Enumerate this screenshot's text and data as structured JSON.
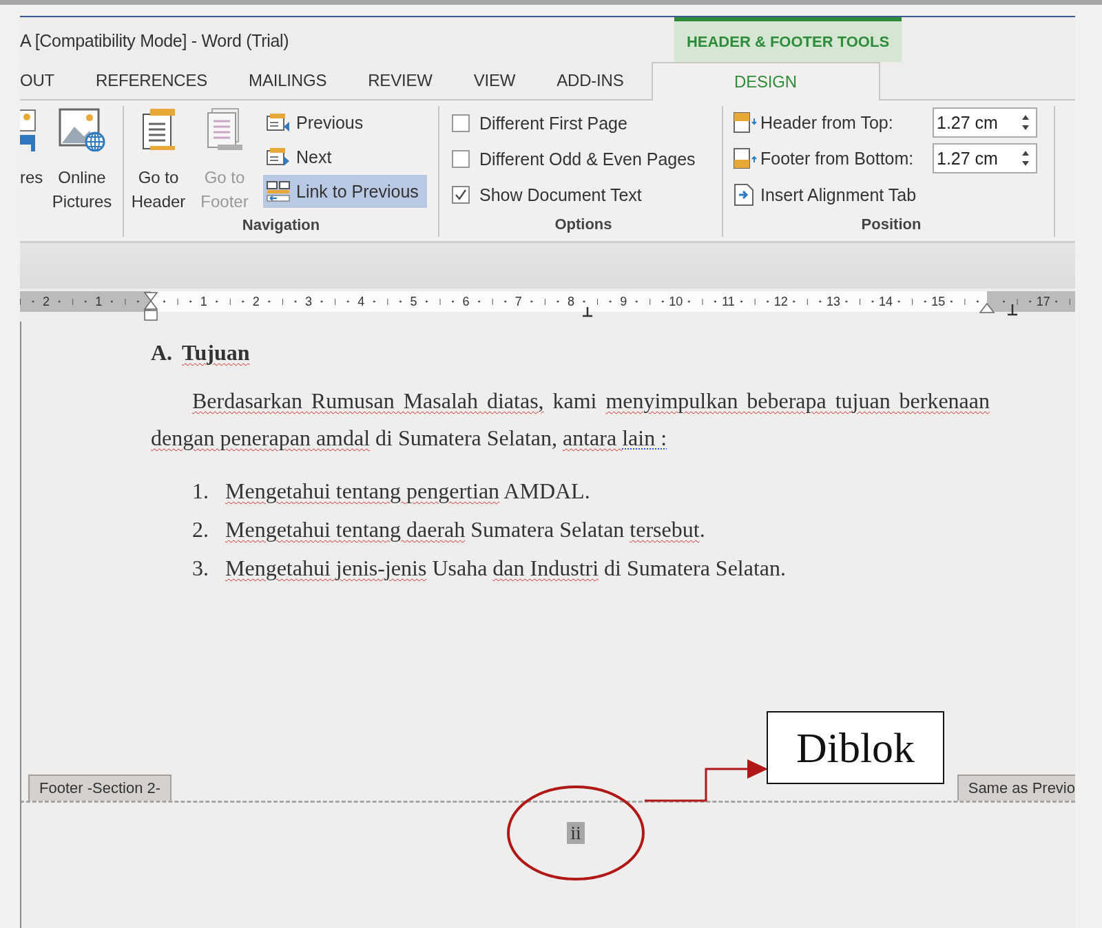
{
  "window": {
    "title": "A [Compatibility Mode] - Word (Trial)"
  },
  "contextual_tab_group": {
    "label": "HEADER & FOOTER TOOLS"
  },
  "tabs": [
    {
      "label": "OUT",
      "selected": false
    },
    {
      "label": "REFERENCES",
      "selected": false
    },
    {
      "label": "MAILINGS",
      "selected": false
    },
    {
      "label": "REVIEW",
      "selected": false
    },
    {
      "label": "VIEW",
      "selected": false
    },
    {
      "label": "ADD-INS",
      "selected": false
    },
    {
      "label": "DESIGN",
      "selected": true
    }
  ],
  "ribbon": {
    "groups": [
      {
        "kind": "images",
        "items": [
          {
            "kind": "large",
            "label": "res",
            "disabled": false
          },
          {
            "kind": "large",
            "label": "Online Pictures",
            "disabled": false
          }
        ]
      },
      {
        "kind": "navigation",
        "title": "Navigation",
        "items": [
          {
            "kind": "large",
            "label": "Go to Header",
            "disabled": false
          },
          {
            "kind": "large",
            "label": "Go to Footer",
            "disabled": true
          },
          {
            "kind": "small",
            "label": "Previous",
            "on": false
          },
          {
            "kind": "small",
            "label": "Next",
            "on": false
          },
          {
            "kind": "small",
            "label": "Link to Previous",
            "on": true
          }
        ]
      },
      {
        "kind": "options",
        "title": "Options",
        "items": [
          {
            "kind": "checkbox",
            "label": "Different First Page",
            "checked": false
          },
          {
            "kind": "checkbox",
            "label": "Different Odd & Even Pages",
            "checked": false
          },
          {
            "kind": "checkbox",
            "label": "Show Document Text",
            "checked": true
          }
        ]
      },
      {
        "kind": "position",
        "title": "Position",
        "items": [
          {
            "kind": "spinner",
            "label": "Header from Top:",
            "value": "1.27 cm"
          },
          {
            "kind": "spinner",
            "label": "Footer from Bottom:",
            "value": "1.27 cm"
          },
          {
            "kind": "action",
            "label": "Insert Alignment Tab"
          }
        ]
      }
    ]
  },
  "ruler": {
    "left_numbers": [
      "2",
      "1"
    ],
    "numbers": [
      "1",
      "2",
      "3",
      "4",
      "5",
      "6",
      "7",
      "8",
      "9",
      "10",
      "11",
      "12",
      "13",
      "14",
      "15"
    ],
    "right_numbers": [
      "17"
    ]
  },
  "document": {
    "heading": {
      "number": "A.",
      "segments": [
        {
          "text": "Tujuan",
          "kind": "misspelled"
        }
      ]
    },
    "paragraph": {
      "segments": [
        {
          "text": "Berdasarkan Rumusan Masalah diatas,",
          "kind": "misspelled"
        },
        {
          "text": " kami ",
          "kind": "plain"
        },
        {
          "text": "menyimpulkan beberapa tujuan berkenaan dengan penerapan amdal",
          "kind": "misspelled"
        },
        {
          "text": " di Sumatera Selatan, ",
          "kind": "plain"
        },
        {
          "text": "antara ",
          "kind": "misspelled"
        },
        {
          "text": "lain :",
          "kind": "grammar"
        }
      ]
    },
    "list": [
      {
        "number": "1.",
        "segments": [
          {
            "text": "Mengetahui tentang pengertian",
            "kind": "misspelled"
          },
          {
            "text": " AMDAL.",
            "kind": "plain"
          }
        ]
      },
      {
        "number": "2.",
        "segments": [
          {
            "text": "Mengetahui tentang daerah",
            "kind": "misspelled"
          },
          {
            "text": " Sumatera Selatan ",
            "kind": "plain"
          },
          {
            "text": "tersebut",
            "kind": "misspelled"
          },
          {
            "text": ".",
            "kind": "plain"
          }
        ]
      },
      {
        "number": "3.",
        "segments": [
          {
            "text": "Mengetahui jenis-jenis",
            "kind": "misspelled"
          },
          {
            "text": " Usaha ",
            "kind": "plain"
          },
          {
            "text": "dan Industri",
            "kind": "misspelled"
          },
          {
            "text": " di Sumatera Selatan.",
            "kind": "plain"
          }
        ]
      }
    ],
    "footer": {
      "label": "Footer -Section 2-",
      "link_label": "Same as Previo",
      "page_number": "ii",
      "page_number_selected": true
    }
  },
  "annotation": {
    "callout": "Diblok"
  }
}
